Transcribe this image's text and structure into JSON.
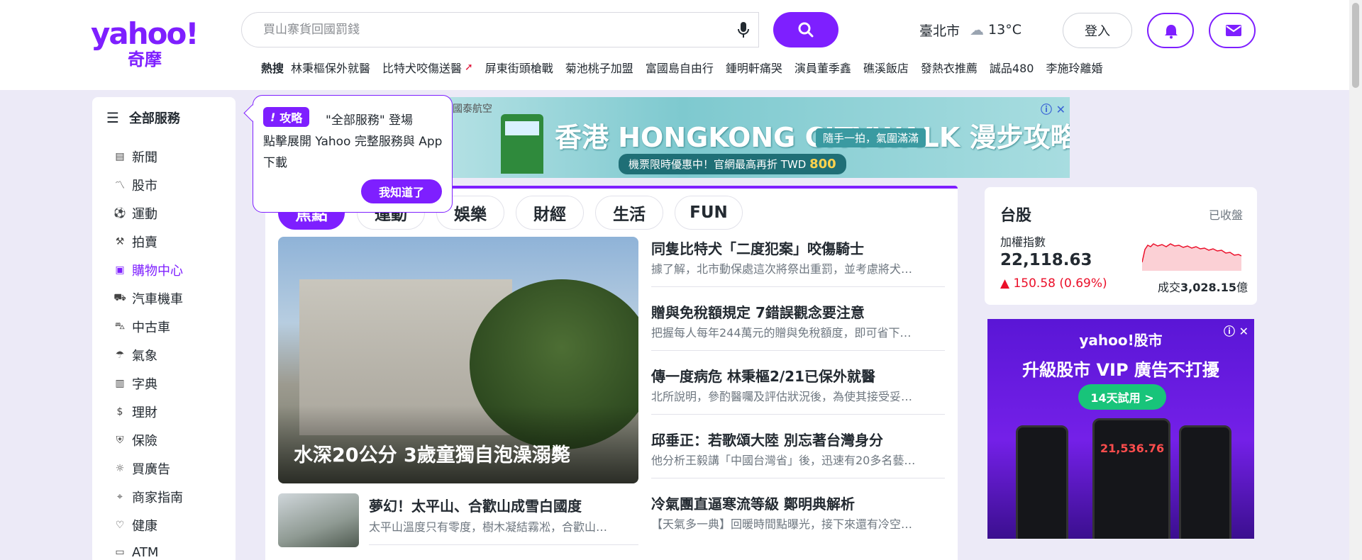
{
  "header": {
    "logo_text": "yahoo!",
    "logo_sub": "奇摩",
    "search_placeholder": "買山寨貨回國罰錢",
    "weather_city": "臺北市",
    "weather_temp": "13°C",
    "login_label": "登入"
  },
  "trending": {
    "label": "熱搜",
    "items": [
      "林秉樞保外就醫",
      "比特犬咬傷送醫",
      "屏東街頭槍戰",
      "菊池桃子加盟",
      "富國島自由行",
      "鍾明軒痛哭",
      "演員董季鑫",
      "礁溪飯店",
      "發熱衣推薦",
      "誠品480",
      "李施玲離婚"
    ]
  },
  "sidebar": {
    "all_services": "全部服務",
    "items": [
      "新聞",
      "股市",
      "運動",
      "拍賣",
      "購物中心",
      "汽車機車",
      "中古車",
      "氣象",
      "字典",
      "理財",
      "保險",
      "買廣告",
      "商家指南",
      "健康",
      "ATM"
    ]
  },
  "tooltip": {
    "badge": "攻略",
    "line1": "\"全部服務\" 登場",
    "line2": "點擊展開 Yahoo 完整服務與 App下載",
    "button": "我知道了"
  },
  "banner": {
    "brand": "國泰航空",
    "title": "香港 HONGKONG CITYWALK 漫步攻略",
    "tag": "隨手一拍，氣圍滿滿",
    "offer": "機票限時優惠中！官網最高再折 TWD",
    "offer_amount": "800"
  },
  "tabs": [
    "焦點",
    "運動",
    "娛樂",
    "財經",
    "生活",
    "FUN"
  ],
  "hero": {
    "caption": "水深20公分 3歲童獨自泡澡溺斃"
  },
  "news": [
    {
      "title": "同隻比特犬「二度犯案」咬傷騎士",
      "summary": "據了解，北市動保處這次將祭出重罰，並考慮將犬…"
    },
    {
      "title": "贈與免稅額規定 7錯誤觀念要注意",
      "summary": "把握每人每年244萬元的贈與免稅額度，即可省下…"
    },
    {
      "title": "傳一度病危 林秉樞2/21已保外就醫",
      "summary": "北所說明，參酌醫囑及評估狀況後，為使其接受妥…"
    },
    {
      "title": "邱垂正：若歌頌大陸 別忘著台灣身分",
      "summary": "他分析王毅講「中國台灣省」後，迅速有20多名藝…"
    },
    {
      "title": "冷氣團直逼寒流等級 鄭明典解析",
      "summary": "【天氣多一典】回暖時間點曝光，接下來還有冷空…"
    }
  ],
  "small_news": {
    "title": "夢幻！太平山、合歡山成雪白國度",
    "summary": "太平山溫度只有零度，樹木凝結霧凇，合歡山…"
  },
  "stock": {
    "title": "台股",
    "status": "已收盤",
    "index_label": "加權指數",
    "value": "22,118.63",
    "change": "▲ 150.58 (0.69%)",
    "volume_label": "成交",
    "volume_value": "3,028.15",
    "volume_unit": "億"
  },
  "vip_ad": {
    "brand": "yahoo!股市",
    "headline": "升級股市 VIP 廣告不打擾",
    "cta": "14天試用 >",
    "phone_number": "21,536.76"
  }
}
